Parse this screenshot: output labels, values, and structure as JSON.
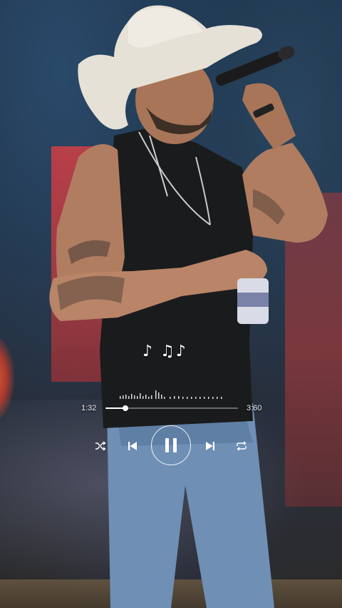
{
  "player": {
    "elapsed": "1:32",
    "duration": "3:60",
    "progress": 0.15,
    "icons": {
      "notes": "music-notes-icon",
      "shuffle": "shuffle-icon",
      "previous": "skip-previous-icon",
      "play_pause": "pause-icon",
      "next": "skip-next-icon",
      "repeat": "repeat-icon"
    }
  },
  "colors": {
    "stage_red": "#d13e44",
    "controls": "#ffffff"
  }
}
